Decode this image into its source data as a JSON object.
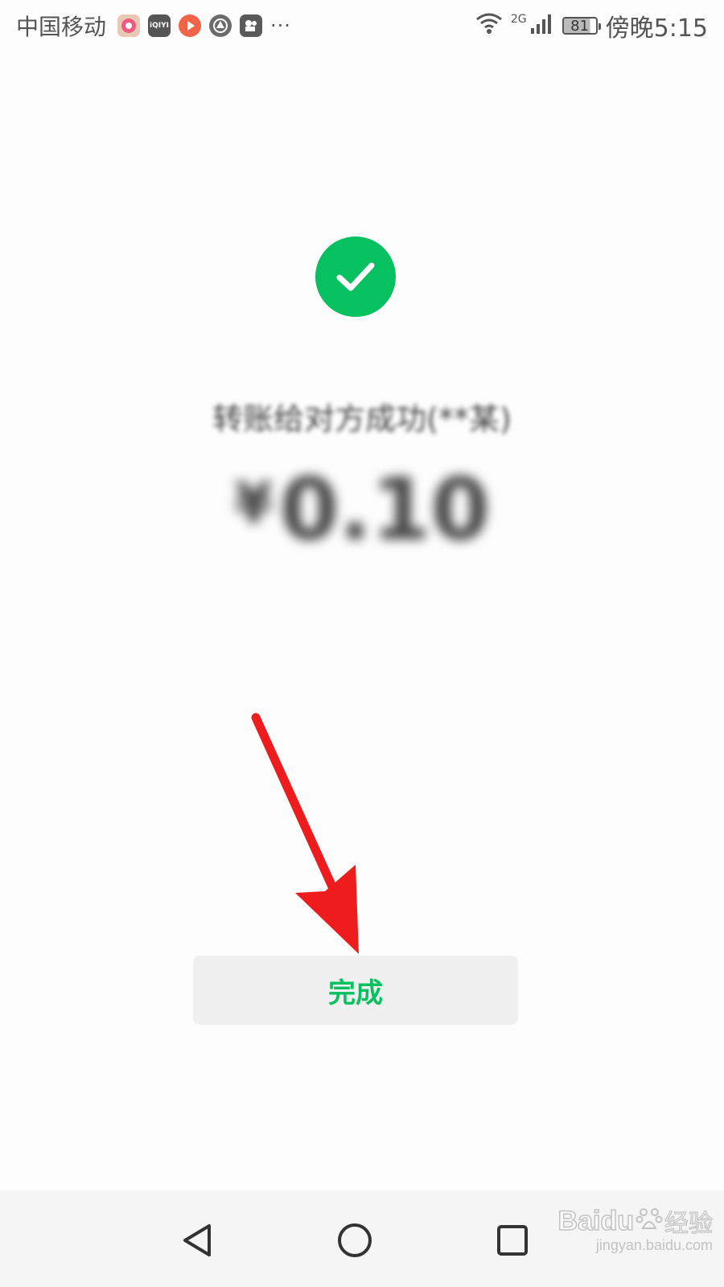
{
  "status_bar": {
    "carrier": "中国移动",
    "ellipsis": "···",
    "network_type": "2G",
    "battery_level": "81",
    "time": "傍晚5:15",
    "app_icons": [
      "video-app-icon",
      "iqiyi-icon",
      "play-app-icon",
      "music-app-icon",
      "camera-app-icon"
    ],
    "iqiyi_label": "iQIYI"
  },
  "result": {
    "status_text": "转账给对方成功(**某)",
    "currency_symbol": "¥",
    "amount": "0.10"
  },
  "actions": {
    "done_label": "完成"
  },
  "navigation": {
    "icons": [
      "back-icon",
      "home-icon",
      "recents-icon"
    ]
  },
  "watermark": {
    "brand": "Baidu",
    "suffix": "经验",
    "url": "jingyan.baidu.com"
  },
  "colors": {
    "accent": "#07c160",
    "button_bg": "#f0f0f0",
    "annotation": "#ee1c1c"
  }
}
